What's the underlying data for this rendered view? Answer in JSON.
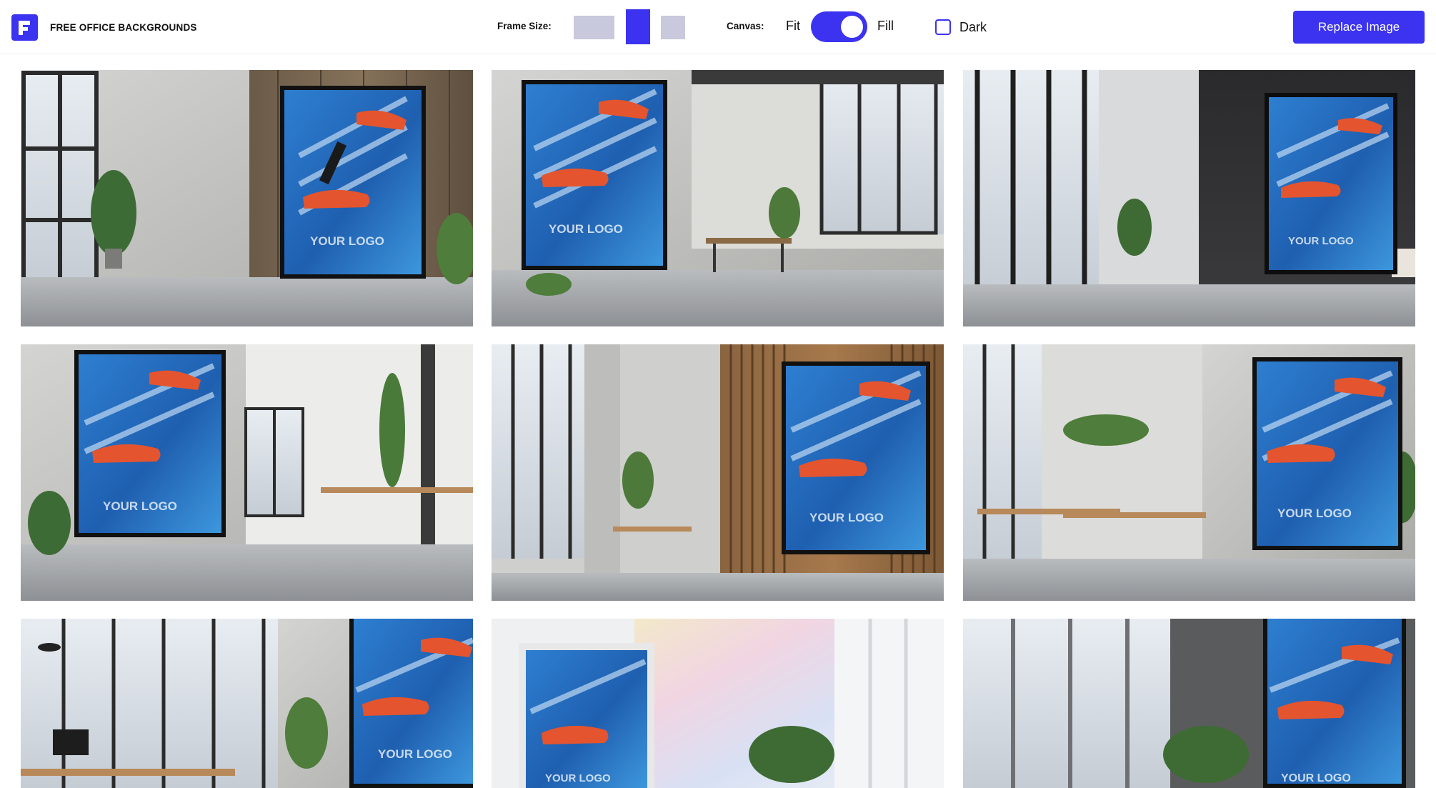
{
  "header": {
    "brand": "FREE OFFICE BACKGROUNDS",
    "frame_size_label": "Frame Size:",
    "canvas_label": "Canvas:",
    "fit_label": "Fit",
    "fill_label": "Fill",
    "dark_label": "Dark",
    "replace_button": "Replace Image",
    "canvas_mode": "Fill",
    "selected_frame": "portrait",
    "dark_checked": false
  },
  "poster": {
    "logo_text": "YOUR LOGO"
  },
  "colors": {
    "accent": "#3b33f0",
    "inactive_frame": "#c8c9dc"
  }
}
